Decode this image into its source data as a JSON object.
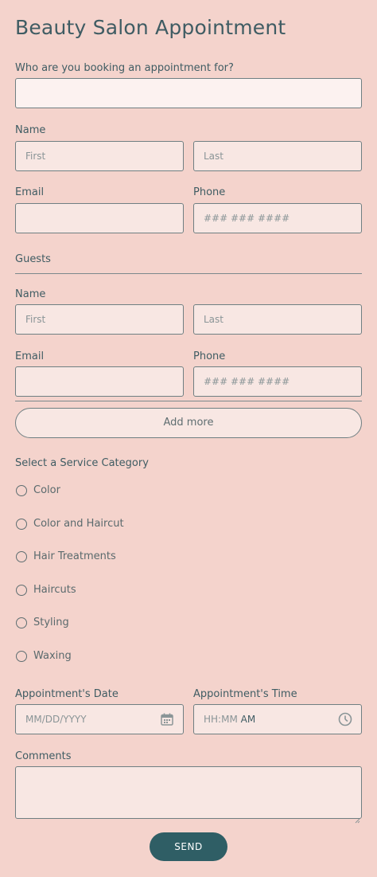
{
  "form": {
    "title": "Beauty Salon Appointment",
    "booking_for_label": "Who are you booking an appointment for?",
    "booking_for_value": "",
    "name_label": "Name",
    "first_placeholder": "First",
    "last_placeholder": "Last",
    "email_label": "Email",
    "phone_label": "Phone",
    "phone_placeholder": "### ### ####",
    "guests_label": "Guests",
    "guest_name_label": "Name",
    "guest_email_label": "Email",
    "guest_phone_label": "Phone",
    "add_more_label": "Add more",
    "service_category_label": "Select a Service Category",
    "services": [
      "Color",
      "Color and Haircut",
      "Hair Treatments",
      "Haircuts",
      "Styling",
      "Waxing"
    ],
    "date_label": "Appointment's Date",
    "date_placeholder": "MM/DD/YYYY",
    "time_label": "Appointment's Time",
    "time_placeholder": "HH:MM",
    "time_ampm": "AM",
    "comments_label": "Comments",
    "send_label": "SEND"
  },
  "icons": {
    "calendar": "calendar-icon",
    "clock": "clock-icon"
  },
  "colors": {
    "background": "#f4d3cc",
    "text": "#3f5c63",
    "button": "#2f5e65",
    "field_bg": "#f8e7e3"
  }
}
